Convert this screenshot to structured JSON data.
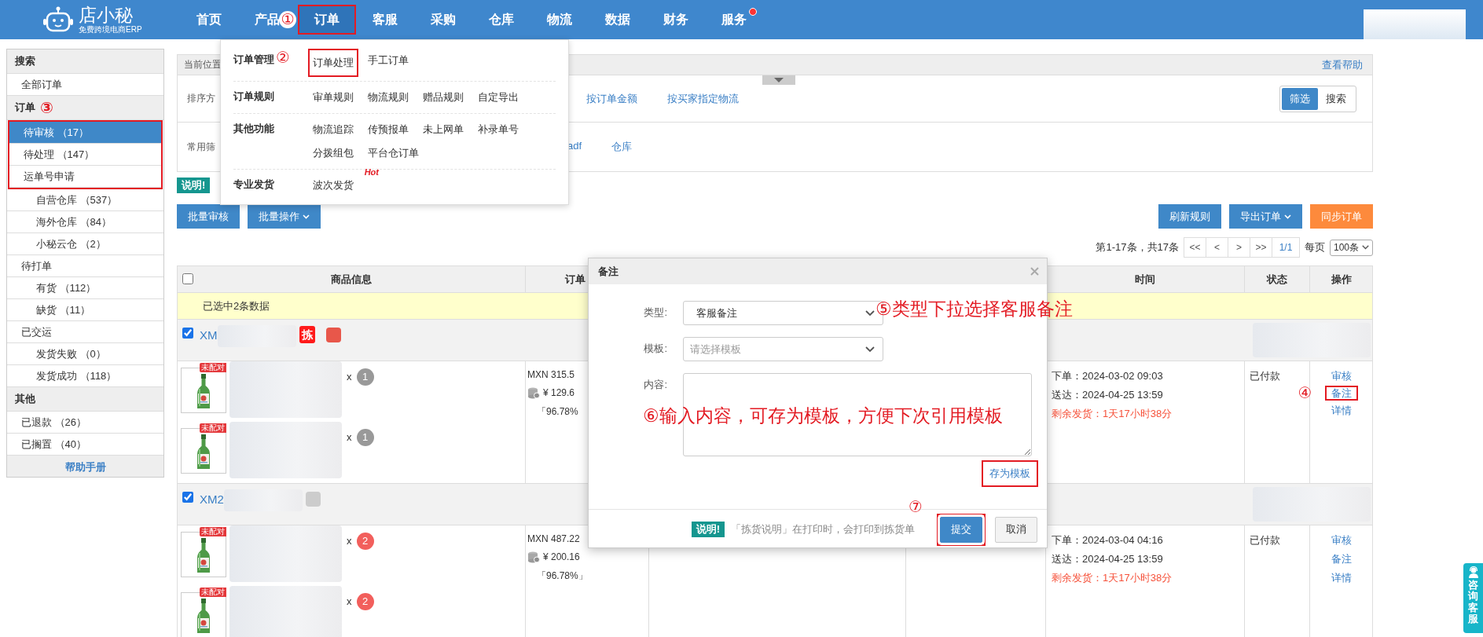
{
  "top_bar": {
    "logo": {
      "name": "店小秘",
      "tagline": "免费跨境电商ERP"
    },
    "nav": [
      {
        "label": "首页",
        "selected": false,
        "outlined": false,
        "dot": false
      },
      {
        "label": "产品",
        "selected": false,
        "outlined": false,
        "dot": false
      },
      {
        "label": "订单",
        "selected": true,
        "outlined": true,
        "dot": false,
        "step": "①"
      },
      {
        "label": "客服",
        "selected": false,
        "outlined": false,
        "dot": false
      },
      {
        "label": "采购",
        "selected": false,
        "outlined": false,
        "dot": false
      },
      {
        "label": "仓库",
        "selected": false,
        "outlined": false,
        "dot": false
      },
      {
        "label": "物流",
        "selected": false,
        "outlined": false,
        "dot": false
      },
      {
        "label": "数据",
        "selected": false,
        "outlined": false,
        "dot": false
      },
      {
        "label": "财务",
        "selected": false,
        "outlined": false,
        "dot": false
      },
      {
        "label": "服务",
        "selected": false,
        "outlined": false,
        "dot": true
      }
    ]
  },
  "order_menu": {
    "groups": [
      {
        "title": "订单管理",
        "step": "②",
        "items": [
          {
            "label": "订单处理",
            "outlined": true
          },
          {
            "label": "手工订单",
            "outlined": false
          }
        ]
      },
      {
        "title": "订单规则",
        "items": [
          {
            "label": "审单规则",
            "outlined": false
          },
          {
            "label": "物流规则",
            "outlined": false
          },
          {
            "label": "赠品规则",
            "outlined": false
          },
          {
            "label": "自定导出",
            "outlined": false
          }
        ]
      },
      {
        "title": "其他功能",
        "items": [
          {
            "label": "物流追踪",
            "outlined": false
          },
          {
            "label": "传预报单",
            "outlined": false
          },
          {
            "label": "未上网单",
            "outlined": false
          },
          {
            "label": "补录单号",
            "outlined": false
          },
          {
            "label": "分拨组包",
            "outlined": false
          },
          {
            "label": "平台仓订单",
            "outlined": false
          }
        ]
      },
      {
        "title": "专业发货",
        "items": [
          {
            "label": "波次发货",
            "outlined": false,
            "badge": "Hot"
          }
        ]
      }
    ]
  },
  "sidebar": {
    "sections": [
      {
        "title": "搜索",
        "items": [
          {
            "label": "全部订单",
            "selected": false,
            "outlined": false
          }
        ]
      },
      {
        "title": "订单",
        "step": "③",
        "items": [
          {
            "label": "待审核 （17）",
            "selected": true,
            "outlined": true
          },
          {
            "label": "待处理 （147）",
            "selected": false,
            "outlined": true
          },
          {
            "label": "运单号申请",
            "selected": false,
            "outlined": true,
            "children": [
              {
                "label": "自营仓库 （537）",
                "selected": false
              },
              {
                "label": "海外仓库 （84）",
                "selected": false
              },
              {
                "label": "小秘云仓 （2）",
                "selected": false
              }
            ]
          },
          {
            "label": "待打单",
            "selected": false,
            "outlined": false,
            "children": [
              {
                "label": "有货 （112）",
                "selected": false
              },
              {
                "label": "缺货 （11）",
                "selected": false
              }
            ]
          },
          {
            "label": "已交运",
            "selected": false,
            "outlined": false,
            "children": [
              {
                "label": "发货失败 （0）",
                "selected": false
              },
              {
                "label": "发货成功 （118）",
                "selected": false
              }
            ]
          }
        ]
      },
      {
        "title": "其他",
        "items": [
          {
            "label": "已退款 （26）",
            "selected": false,
            "outlined": false
          },
          {
            "label": "已搁置 （40）",
            "selected": false,
            "outlined": false
          }
        ]
      }
    ],
    "help_link": "帮助手册"
  },
  "breadcrumb": {
    "label": "当前位置",
    "help_link": "查看帮助"
  },
  "sort_row": {
    "label": "排序方",
    "options": [
      "按订单金额",
      "按买家指定物流"
    ]
  },
  "view_toggle": [
    {
      "label": "筛选",
      "selected": true
    },
    {
      "label": "搜索",
      "selected": false
    }
  ],
  "filter_row": {
    "label": "常用筛",
    "options": [
      "adf",
      "仓库"
    ]
  },
  "notice_badge": "说明!",
  "batch_buttons": [
    {
      "label": "批量审核",
      "caret": false
    },
    {
      "label": "批量操作",
      "caret": true
    }
  ],
  "action_buttons": [
    {
      "label": "刷新规则",
      "kind": "primary",
      "caret": false
    },
    {
      "label": "导出订单",
      "kind": "primary",
      "caret": true
    },
    {
      "label": "同步订单",
      "kind": "warning",
      "caret": false
    }
  ],
  "pagination": {
    "summary": "第1-17条，共17条",
    "buttons": [
      "<<",
      "<",
      ">",
      ">>"
    ],
    "page": "1/1",
    "per_page_label": "每页",
    "per_page": "100条"
  },
  "table": {
    "select_all": false,
    "columns": [
      "商品信息",
      "订单",
      "时间",
      "状态",
      "操作"
    ],
    "selection_notice": "已选中2条数据",
    "orders": [
      {
        "checked": true,
        "number": "XM",
        "tags": [
          {
            "kind": "label",
            "text": "拣",
            "color": "#ff1a1a"
          },
          {
            "kind": "square",
            "color": "#e8574a"
          }
        ],
        "items": [
          {
            "badge": "未配对",
            "sign": "x",
            "quantity": "1",
            "color": "#999999"
          },
          {
            "badge": "未配对",
            "sign": "x",
            "quantity": "1",
            "color": "#999999"
          }
        ],
        "amount": "MXN 315.5",
        "cost": "¥ 129.6",
        "ratio": "「96.78%",
        "times": [
          "下单：2024-03-02 09:03",
          "送达：2024-04-25 13:59"
        ],
        "remaining": "剩余发货：1天17小时38分",
        "status": "已付款",
        "actions": [
          {
            "label": "审核",
            "outlined": false
          },
          {
            "label": "备注",
            "outlined": true,
            "step": "④"
          },
          {
            "label": "详情",
            "outlined": false
          }
        ]
      },
      {
        "checked": true,
        "number": "XM2",
        "tags": [
          {
            "kind": "square",
            "color": "#cccccc"
          }
        ],
        "items": [
          {
            "badge": "未配对",
            "sign": "x",
            "quantity": "2",
            "color": "#f25f5c"
          },
          {
            "badge": "未配对",
            "sign": "x",
            "quantity": "2",
            "color": "#f25f5c"
          }
        ],
        "amount": "MXN 487.22",
        "cost": "¥ 200.16",
        "ratio": "「96.78%」",
        "times": [
          "下单：2024-03-04 04:16",
          "送达：2024-04-25 13:59"
        ],
        "remaining": "剩余发货：1天17小时38分",
        "status": "已付款",
        "actions": [
          {
            "label": "审核",
            "outlined": false
          },
          {
            "label": "备注",
            "outlined": false
          },
          {
            "label": "详情",
            "outlined": false
          }
        ]
      }
    ]
  },
  "dialog": {
    "title": "备注",
    "fields": [
      {
        "kind": "select",
        "label": "类型:",
        "value": "客服备注"
      },
      {
        "kind": "select",
        "label": "模板:",
        "placeholder": "请选择模板"
      },
      {
        "kind": "textarea",
        "label": "内容:"
      }
    ],
    "save_template": {
      "label": "存为模板",
      "outlined": true
    },
    "footer_notice": {
      "badge": "说明!",
      "text": "「拣货说明」在打印时，会打印到拣货单"
    },
    "buttons": [
      {
        "label": "提交",
        "kind": "primary",
        "outlined": true,
        "step": "⑦"
      },
      {
        "label": "取消",
        "kind": "default",
        "outlined": false
      }
    ]
  },
  "callouts": [
    "⑤类型下拉选择客服备注",
    "⑥输入内容，可存为模板，方便下次引用模板"
  ],
  "help_tab": "咨询客服"
}
